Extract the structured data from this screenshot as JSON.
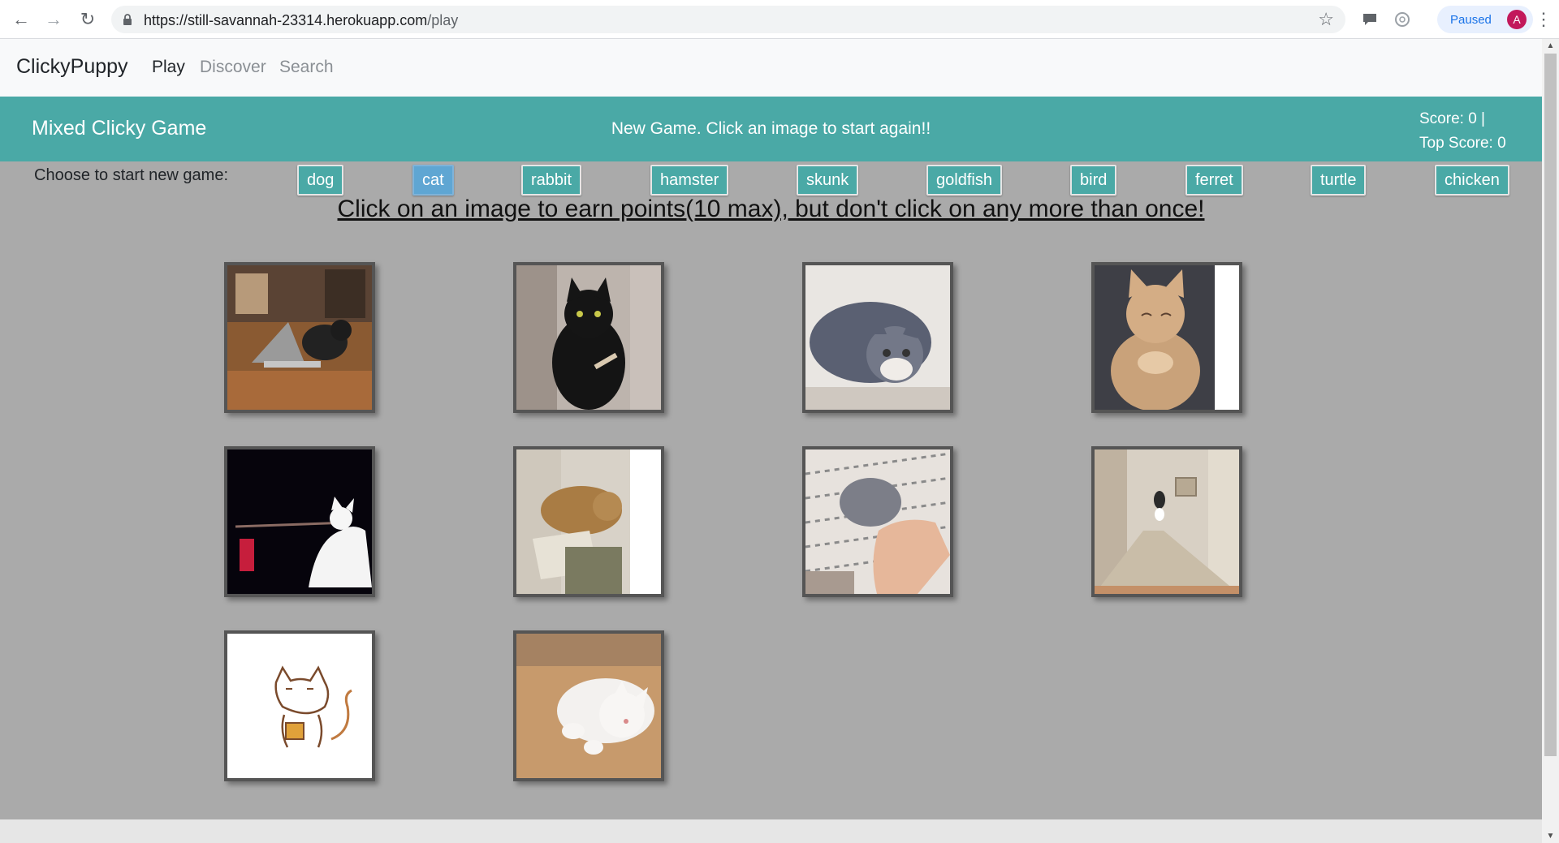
{
  "browser": {
    "url_host": "https://still-savannah-23314.herokuapp.com",
    "url_path": "/play",
    "profile_status": "Paused",
    "profile_initial": "A"
  },
  "navbar": {
    "brand": "ClickyPuppy",
    "links": [
      "Play",
      "Discover",
      "Search"
    ],
    "active": "Play"
  },
  "banner": {
    "title": "Mixed Clicky Game",
    "message": "New Game. Click an image to start again!!",
    "score_line": "Score: 0 |",
    "top_score_line": "Top Score: 0"
  },
  "chooser": {
    "label": "Choose to start new game:",
    "animals": [
      "dog",
      "cat",
      "rabbit",
      "hamster",
      "skunk",
      "goldfish",
      "bird",
      "ferret",
      "turtle",
      "chicken"
    ],
    "selected": "cat"
  },
  "instructions": "Click on an image to earn points(10 max), but don't click on any more than once!",
  "colors": {
    "accent": "#4aa9a6",
    "background": "#aaaaaa",
    "selected_button": "#5fa6d3"
  },
  "tiles": [
    "cat-on-laptop-image",
    "black-cat-image",
    "crouching-tabby-cat-image",
    "orange-cat-clapping-image",
    "white-cat-with-toy-image",
    "cat-with-book-image",
    "gray-kitten-petted-image",
    "cat-in-hallway-image",
    "cartoon-cat-drawing-image",
    "white-cat-on-floor-image"
  ]
}
